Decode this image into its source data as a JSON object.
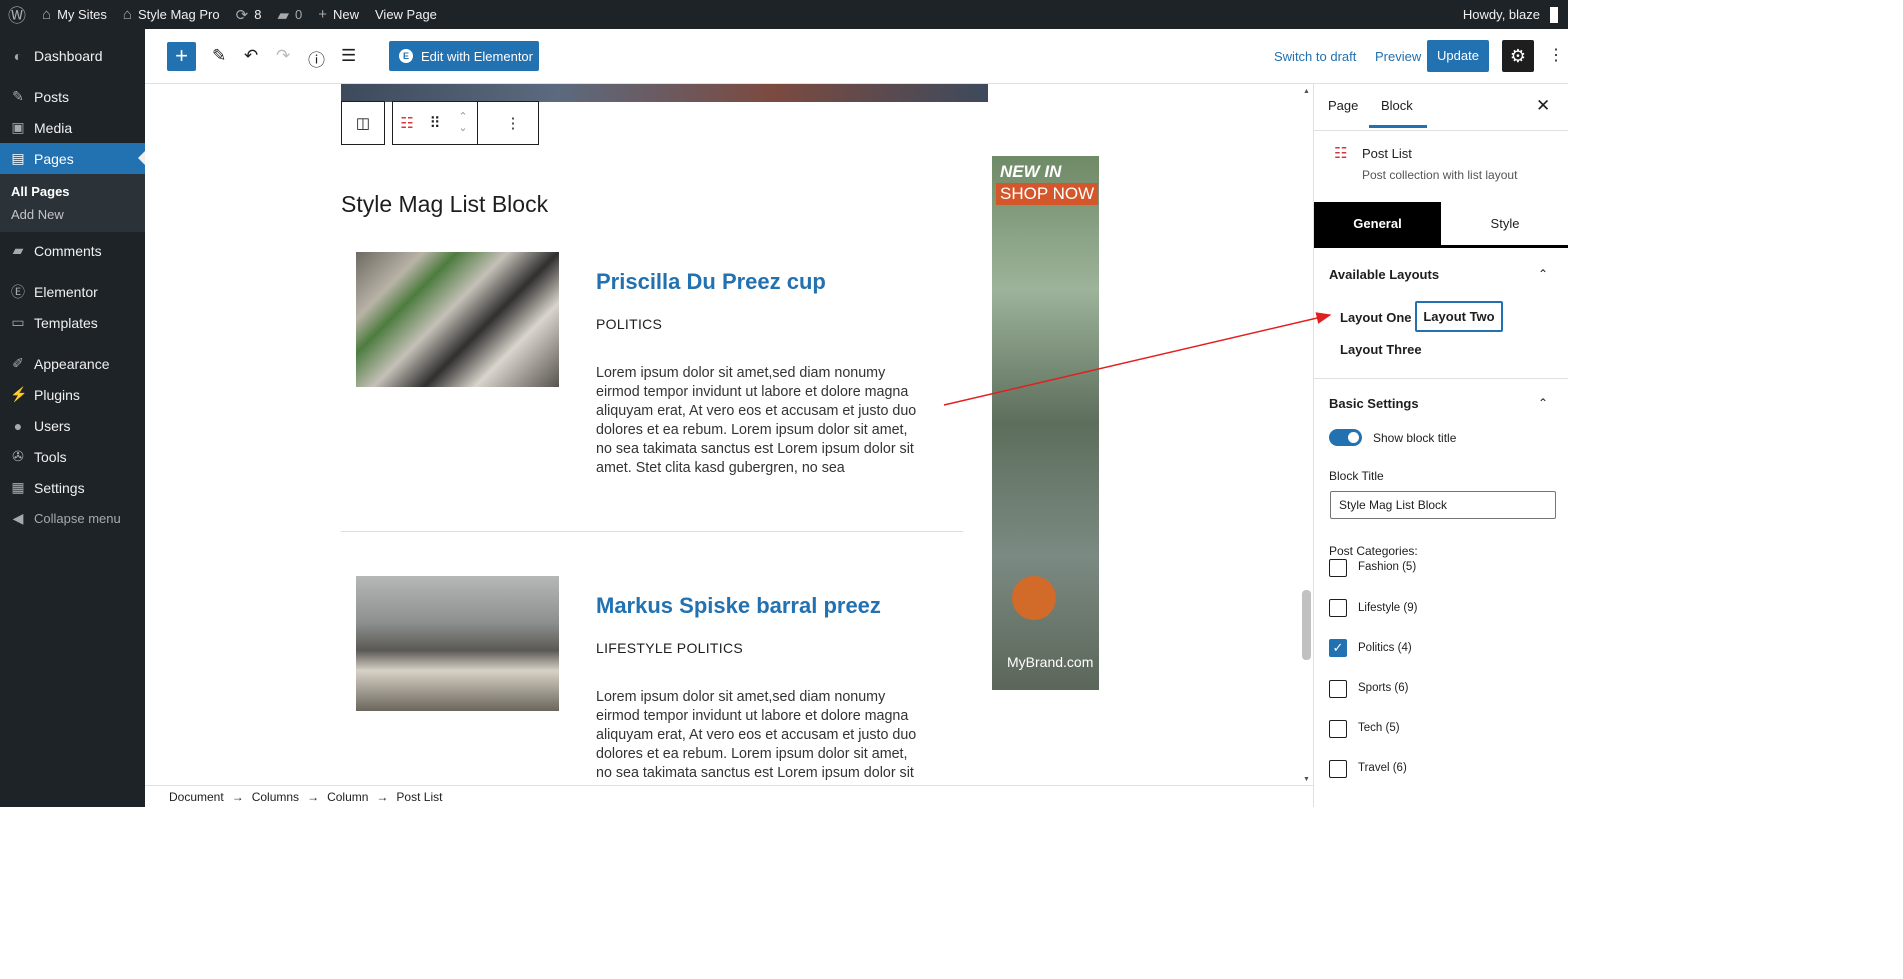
{
  "admin_bar": {
    "my_sites": "My Sites",
    "site_name": "Style Mag Pro",
    "updates": "8",
    "comments": "0",
    "new": "New",
    "view_page": "View Page",
    "howdy": "Howdy, blaze"
  },
  "sidebar": {
    "items": [
      {
        "label": "Dashboard",
        "icon": "dashboard-icon"
      },
      {
        "label": "Posts",
        "icon": "pin-icon"
      },
      {
        "label": "Media",
        "icon": "media-icon"
      },
      {
        "label": "Pages",
        "icon": "page-icon"
      },
      {
        "label": "Comments",
        "icon": "comment-icon"
      },
      {
        "label": "Elementor",
        "icon": "elementor-icon"
      },
      {
        "label": "Templates",
        "icon": "folder-icon"
      },
      {
        "label": "Appearance",
        "icon": "brush-icon"
      },
      {
        "label": "Plugins",
        "icon": "plug-icon"
      },
      {
        "label": "Users",
        "icon": "user-icon"
      },
      {
        "label": "Tools",
        "icon": "wrench-icon"
      },
      {
        "label": "Settings",
        "icon": "settings-icon"
      },
      {
        "label": "Collapse menu",
        "icon": "collapse-icon"
      }
    ],
    "sub_all_pages": "All Pages",
    "sub_add_new": "Add New"
  },
  "toolbar": {
    "edit_elementor": "Edit with Elementor",
    "switch_draft": "Switch to draft",
    "preview": "Preview",
    "update": "Update"
  },
  "content": {
    "block_title": "Style Mag List Block",
    "posts": [
      {
        "title": "Priscilla Du Preez cup",
        "categories": "POLITICS",
        "excerpt": "Lorem ipsum dolor sit amet,sed diam nonumy eirmod tempor invidunt ut labore et dolore magna aliquyam erat, At vero eos et accusam et justo duo dolores et ea rebum. Lorem ipsum dolor sit amet, no sea takimata sanctus est Lorem ipsum dolor sit amet. Stet clita kasd gubergren, no sea"
      },
      {
        "title": "Markus Spiske barral preez",
        "categories": "LIFESTYLE POLITICS",
        "excerpt": "Lorem ipsum dolor sit amet,sed diam nonumy eirmod tempor invidunt ut labore et dolore magna aliquyam erat, At vero eos et accusam et justo duo dolores et ea rebum. Lorem ipsum dolor sit amet, no sea takimata sanctus est Lorem ipsum dolor sit"
      }
    ],
    "ad": {
      "line1": "NEW IN",
      "line2": "SHOP NOW",
      "brand": "MyBrand.com"
    }
  },
  "breadcrumb": [
    "Document",
    "Columns",
    "Column",
    "Post List"
  ],
  "panel": {
    "tabs": [
      "Page",
      "Block"
    ],
    "block_name": "Post List",
    "block_desc": "Post collection with list layout",
    "sub_tabs": [
      "General",
      "Style"
    ],
    "layouts_heading": "Available Layouts",
    "layouts": [
      "Layout One",
      "Layout Two",
      "Layout Three"
    ],
    "basic_heading": "Basic Settings",
    "show_title_label": "Show block title",
    "block_title_label": "Block Title",
    "block_title_value": "Style Mag List Block",
    "post_categories_label": "Post Categories:",
    "categories": [
      {
        "label": "Fashion (5)",
        "checked": false
      },
      {
        "label": "Lifestyle (9)",
        "checked": false
      },
      {
        "label": "Politics (4)",
        "checked": true
      },
      {
        "label": "Sports (6)",
        "checked": false
      },
      {
        "label": "Tech (5)",
        "checked": false
      },
      {
        "label": "Travel (6)",
        "checked": false
      }
    ]
  },
  "colors": {
    "accent": "#2271b1",
    "admin_dark": "#1d2327",
    "annotation_arrow": "#e02020"
  }
}
